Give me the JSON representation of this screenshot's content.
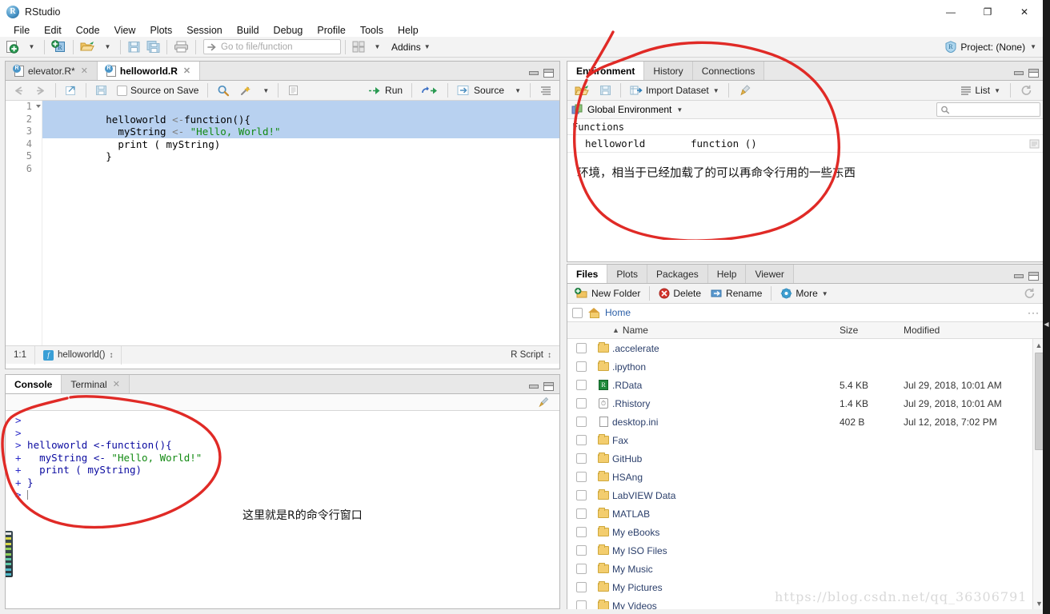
{
  "window": {
    "app_title": "RStudio",
    "logo_text": "R",
    "minimize": "—",
    "maximize": "❐",
    "close": "✕"
  },
  "menubar": {
    "items": [
      {
        "label": "File"
      },
      {
        "label": "Edit"
      },
      {
        "label": "Code"
      },
      {
        "label": "View"
      },
      {
        "label": "Plots"
      },
      {
        "label": "Session"
      },
      {
        "label": "Build"
      },
      {
        "label": "Debug"
      },
      {
        "label": "Profile"
      },
      {
        "label": "Tools"
      },
      {
        "label": "Help"
      }
    ]
  },
  "toolbar": {
    "new_file_icon": "new-file-icon",
    "new_project_icon": "new-project-icon",
    "open_icon": "open-folder-icon",
    "save_icon": "save-icon",
    "save_all_icon": "save-all-icon",
    "print_icon": "print-icon",
    "goto_placeholder": "Go to file/function",
    "workspace_panes_icon": "pane-layout-icon",
    "addins_label": "Addins",
    "project_label": "Project: (None)"
  },
  "source_pane": {
    "tabs": [
      {
        "label": "elevator.R*",
        "active": false,
        "closable": true
      },
      {
        "label": "helloworld.R",
        "active": true,
        "closable": true
      }
    ],
    "toolbar": {
      "back_icon": "back-arrow-icon",
      "forward_icon": "forward-arrow-icon",
      "popout_icon": "show-in-new-window-icon",
      "save_icon": "save-icon",
      "source_on_save_label": "Source on Save",
      "find_icon": "search-icon",
      "magic_icon": "code-tools-icon",
      "compile_icon": "compile-report-icon",
      "run_label": "Run",
      "rerun_icon": "re-run-icon",
      "source_label": "Source",
      "outline_icon": "document-outline-icon"
    },
    "code": {
      "lines": [
        {
          "n": "1",
          "fold": true,
          "selected": true,
          "segments": [
            {
              "t": "helloworld ",
              "c": "tok-id"
            },
            {
              "t": "<-",
              "c": "tok-op"
            },
            {
              "t": "function",
              "c": "tok-id"
            },
            {
              "t": "(){",
              "c": "tok-id"
            }
          ]
        },
        {
          "n": "2",
          "fold": false,
          "selected": true,
          "segments": [
            {
              "t": "  myString ",
              "c": "tok-id"
            },
            {
              "t": "<- ",
              "c": "tok-op"
            },
            {
              "t": "\"Hello, World!\"",
              "c": "tok-str"
            }
          ]
        },
        {
          "n": "3",
          "fold": false,
          "selected": true,
          "segments": [
            {
              "t": "  print ( myString)",
              "c": "tok-id"
            }
          ]
        },
        {
          "n": "4",
          "fold": false,
          "selected": false,
          "segments": [
            {
              "t": "}",
              "c": "tok-id"
            }
          ]
        },
        {
          "n": "5",
          "fold": false,
          "selected": false,
          "segments": []
        },
        {
          "n": "6",
          "fold": false,
          "selected": false,
          "segments": []
        }
      ]
    },
    "status": {
      "cursor_position": "1:1",
      "scope_label": "helloworld()",
      "file_type": "R Script"
    }
  },
  "console_pane": {
    "tabs": [
      {
        "label": "Console",
        "active": true,
        "closable": false
      },
      {
        "label": "Terminal",
        "active": false,
        "closable": true
      }
    ],
    "lines": [
      {
        "prefix": ">",
        "segments": []
      },
      {
        "prefix": ">",
        "segments": []
      },
      {
        "prefix": ">",
        "segments": [
          {
            "t": " helloworld ",
            "c": "ctext"
          },
          {
            "t": "<-function(){",
            "c": "ctext"
          }
        ]
      },
      {
        "prefix": "+",
        "segments": [
          {
            "t": "   myString <- ",
            "c": "ctext"
          },
          {
            "t": "\"Hello, World!\"",
            "c": "cstr"
          }
        ]
      },
      {
        "prefix": "+",
        "segments": [
          {
            "t": "   print ( myString)",
            "c": "ctext"
          }
        ]
      },
      {
        "prefix": "+",
        "segments": [
          {
            "t": " }",
            "c": "ctext"
          }
        ]
      },
      {
        "prefix": ">",
        "segments": []
      }
    ],
    "annotation_note": "这里就是R的命令行窗口"
  },
  "environment_pane": {
    "tabs": [
      {
        "label": "Environment",
        "active": true
      },
      {
        "label": "History",
        "active": false
      },
      {
        "label": "Connections",
        "active": false
      }
    ],
    "toolbar": {
      "load_icon": "load-workspace-icon",
      "save_icon": "save-workspace-icon",
      "import_dataset_label": "Import Dataset",
      "broom_icon": "clear-objects-icon",
      "list_label": "List",
      "refresh_icon": "refresh-icon"
    },
    "scope_label": "Global Environment",
    "search_placeholder": "",
    "section_label": "Functions",
    "objects": [
      {
        "name": "helloworld",
        "value": "function ()",
        "detail_icon": "view-function-icon"
      }
    ],
    "annotation_note": "环境，相当于已经加载了的可以再命令行用的一些东西"
  },
  "files_pane": {
    "tabs": [
      {
        "label": "Files",
        "active": true
      },
      {
        "label": "Plots",
        "active": false
      },
      {
        "label": "Packages",
        "active": false
      },
      {
        "label": "Help",
        "active": false
      },
      {
        "label": "Viewer",
        "active": false
      }
    ],
    "toolbar": {
      "new_folder_label": "New Folder",
      "delete_label": "Delete",
      "rename_label": "Rename",
      "more_label": "More",
      "refresh_icon": "refresh-icon"
    },
    "breadcrumb": "Home",
    "more_dots": "···",
    "columns": {
      "name": "Name",
      "size": "Size",
      "modified": "Modified",
      "sort_arrow": "▲"
    },
    "rows": [
      {
        "icon": "folder-icon",
        "name": ".accelerate",
        "size": "",
        "modified": ""
      },
      {
        "icon": "folder-icon",
        "name": ".ipython",
        "size": "",
        "modified": ""
      },
      {
        "icon": "rdata-icon",
        "name": ".RData",
        "size": "5.4 KB",
        "modified": "Jul 29, 2018, 10:01 AM"
      },
      {
        "icon": "history-icon",
        "name": ".Rhistory",
        "size": "1.4 KB",
        "modified": "Jul 29, 2018, 10:01 AM"
      },
      {
        "icon": "document-icon",
        "name": "desktop.ini",
        "size": "402 B",
        "modified": "Jul 12, 2018, 7:02 PM"
      },
      {
        "icon": "folder-icon",
        "name": "Fax",
        "size": "",
        "modified": ""
      },
      {
        "icon": "folder-icon",
        "name": "GitHub",
        "size": "",
        "modified": ""
      },
      {
        "icon": "folder-icon",
        "name": "HSAng",
        "size": "",
        "modified": ""
      },
      {
        "icon": "folder-icon",
        "name": "LabVIEW Data",
        "size": "",
        "modified": ""
      },
      {
        "icon": "folder-icon",
        "name": "MATLAB",
        "size": "",
        "modified": ""
      },
      {
        "icon": "folder-icon",
        "name": "My eBooks",
        "size": "",
        "modified": ""
      },
      {
        "icon": "folder-icon",
        "name": "My ISO Files",
        "size": "",
        "modified": ""
      },
      {
        "icon": "folder-icon",
        "name": "My Music",
        "size": "",
        "modified": ""
      },
      {
        "icon": "folder-icon",
        "name": "My Pictures",
        "size": "",
        "modified": ""
      },
      {
        "icon": "folder-icon",
        "name": "My Videos",
        "size": "",
        "modified": ""
      }
    ]
  },
  "watermark": "https://blog.csdn.net/qq_36306791",
  "colors": {
    "annotation_red": "#e02a26",
    "selection_blue": "#b8d1f0",
    "string_green": "#138a13",
    "console_blue": "#2c2cc8",
    "link_blue": "#2b3f6b"
  }
}
